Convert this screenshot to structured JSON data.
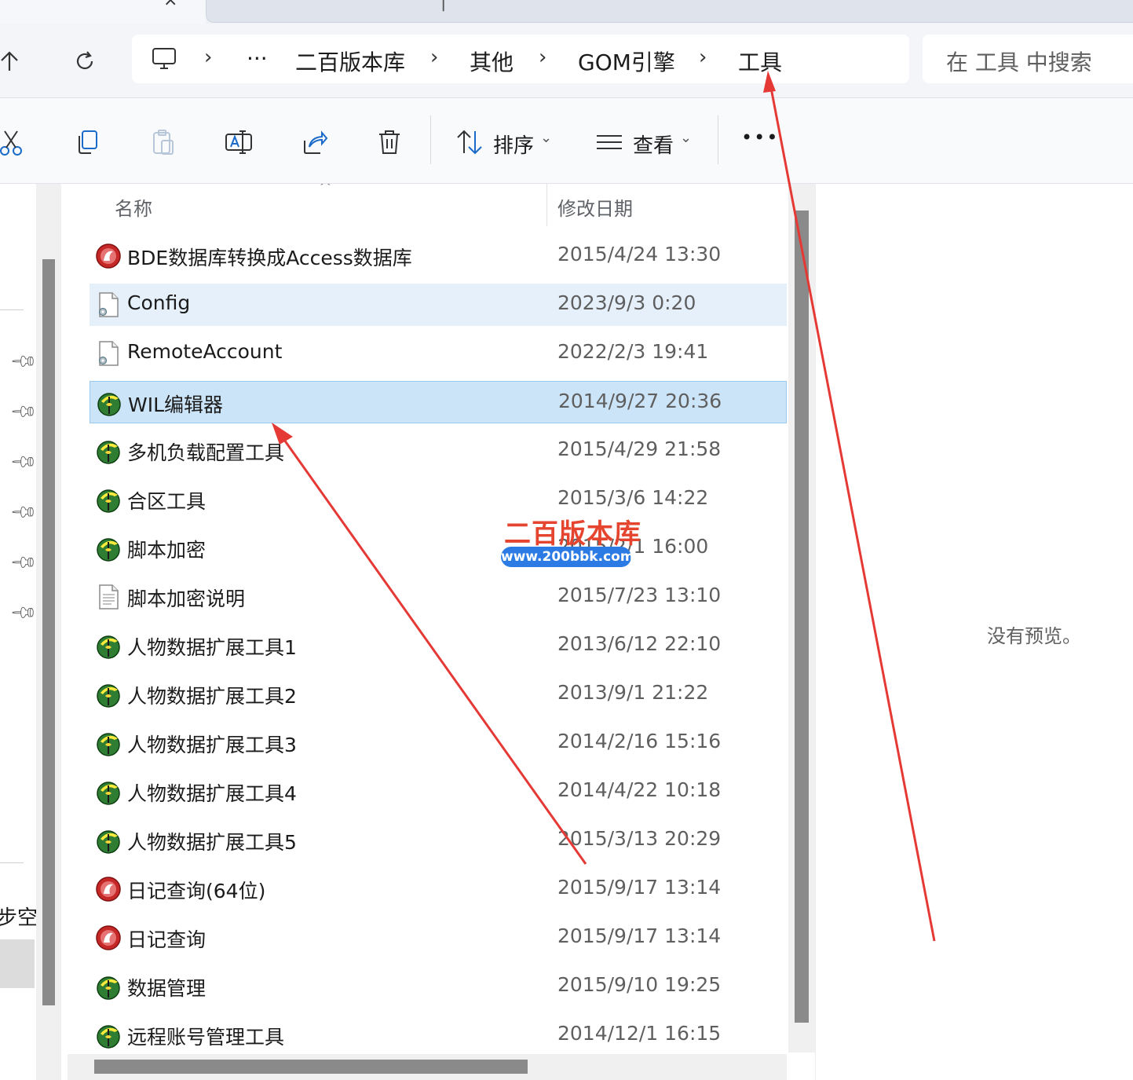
{
  "breadcrumb": {
    "overflow": "···",
    "items": [
      "二百版本库",
      "其他",
      "GOM引擎",
      "工具"
    ]
  },
  "search": {
    "placeholder": "在 工具 中搜索"
  },
  "toolbar": {
    "sort_label": "排序",
    "view_label": "查看",
    "more_label": "•••",
    "icons": [
      "cut-icon",
      "copy-icon",
      "paste-icon",
      "rename-icon",
      "share-icon",
      "delete-icon"
    ]
  },
  "columns": {
    "name": "名称",
    "modified": "修改日期"
  },
  "files": [
    {
      "name": "BDE数据库转换成Access数据库",
      "date": "2015/4/24 13:30",
      "icon": "red-app-icon",
      "state": ""
    },
    {
      "name": "Config",
      "date": "2023/9/3 0:20",
      "icon": "config-file-icon",
      "state": "hover"
    },
    {
      "name": "RemoteAccount",
      "date": "2022/2/3 19:41",
      "icon": "config-file-icon",
      "state": ""
    },
    {
      "name": "WIL编辑器",
      "date": "2014/9/27 20:36",
      "icon": "green-app-icon",
      "state": "selected"
    },
    {
      "name": "多机负载配置工具",
      "date": "2015/4/29 21:58",
      "icon": "green-app-icon",
      "state": ""
    },
    {
      "name": "合区工具",
      "date": "2015/3/6 14:22",
      "icon": "green-app-icon",
      "state": ""
    },
    {
      "name": "脚本加密",
      "date": "2015/2/1 16:00",
      "icon": "green-app-icon",
      "state": ""
    },
    {
      "name": "脚本加密说明",
      "date": "2015/7/23 13:10",
      "icon": "text-file-icon",
      "state": ""
    },
    {
      "name": "人物数据扩展工具1",
      "date": "2013/6/12 22:10",
      "icon": "green-app-icon",
      "state": ""
    },
    {
      "name": "人物数据扩展工具2",
      "date": "2013/9/1 21:22",
      "icon": "green-app-icon",
      "state": ""
    },
    {
      "name": "人物数据扩展工具3",
      "date": "2014/2/16 15:16",
      "icon": "green-app-icon",
      "state": ""
    },
    {
      "name": "人物数据扩展工具4",
      "date": "2014/4/22 10:18",
      "icon": "green-app-icon",
      "state": ""
    },
    {
      "name": "人物数据扩展工具5",
      "date": "2015/3/13 20:29",
      "icon": "green-app-icon",
      "state": ""
    },
    {
      "name": "日记查询(64位)",
      "date": "2015/9/17 13:14",
      "icon": "red-app-icon",
      "state": ""
    },
    {
      "name": "日记查询",
      "date": "2015/9/17 13:14",
      "icon": "red-app-icon",
      "state": ""
    },
    {
      "name": "数据管理",
      "date": "2015/9/10 19:25",
      "icon": "green-app-icon",
      "state": ""
    },
    {
      "name": "远程账号管理工具",
      "date": "2014/12/1 16:15",
      "icon": "green-app-icon",
      "state": ""
    }
  ],
  "left_pane": {
    "partial_label": "步空|"
  },
  "preview": {
    "text": "没有预览。"
  },
  "watermark": {
    "title": "二百版本库",
    "url": "www.200bbk.com"
  },
  "colors": {
    "selected_row": "#cce4f7",
    "hover_row": "#e5f0fb",
    "annotation_arrow": "#e53935",
    "watermark_red": "#e5452f",
    "watermark_blue": "#2c7be5"
  }
}
